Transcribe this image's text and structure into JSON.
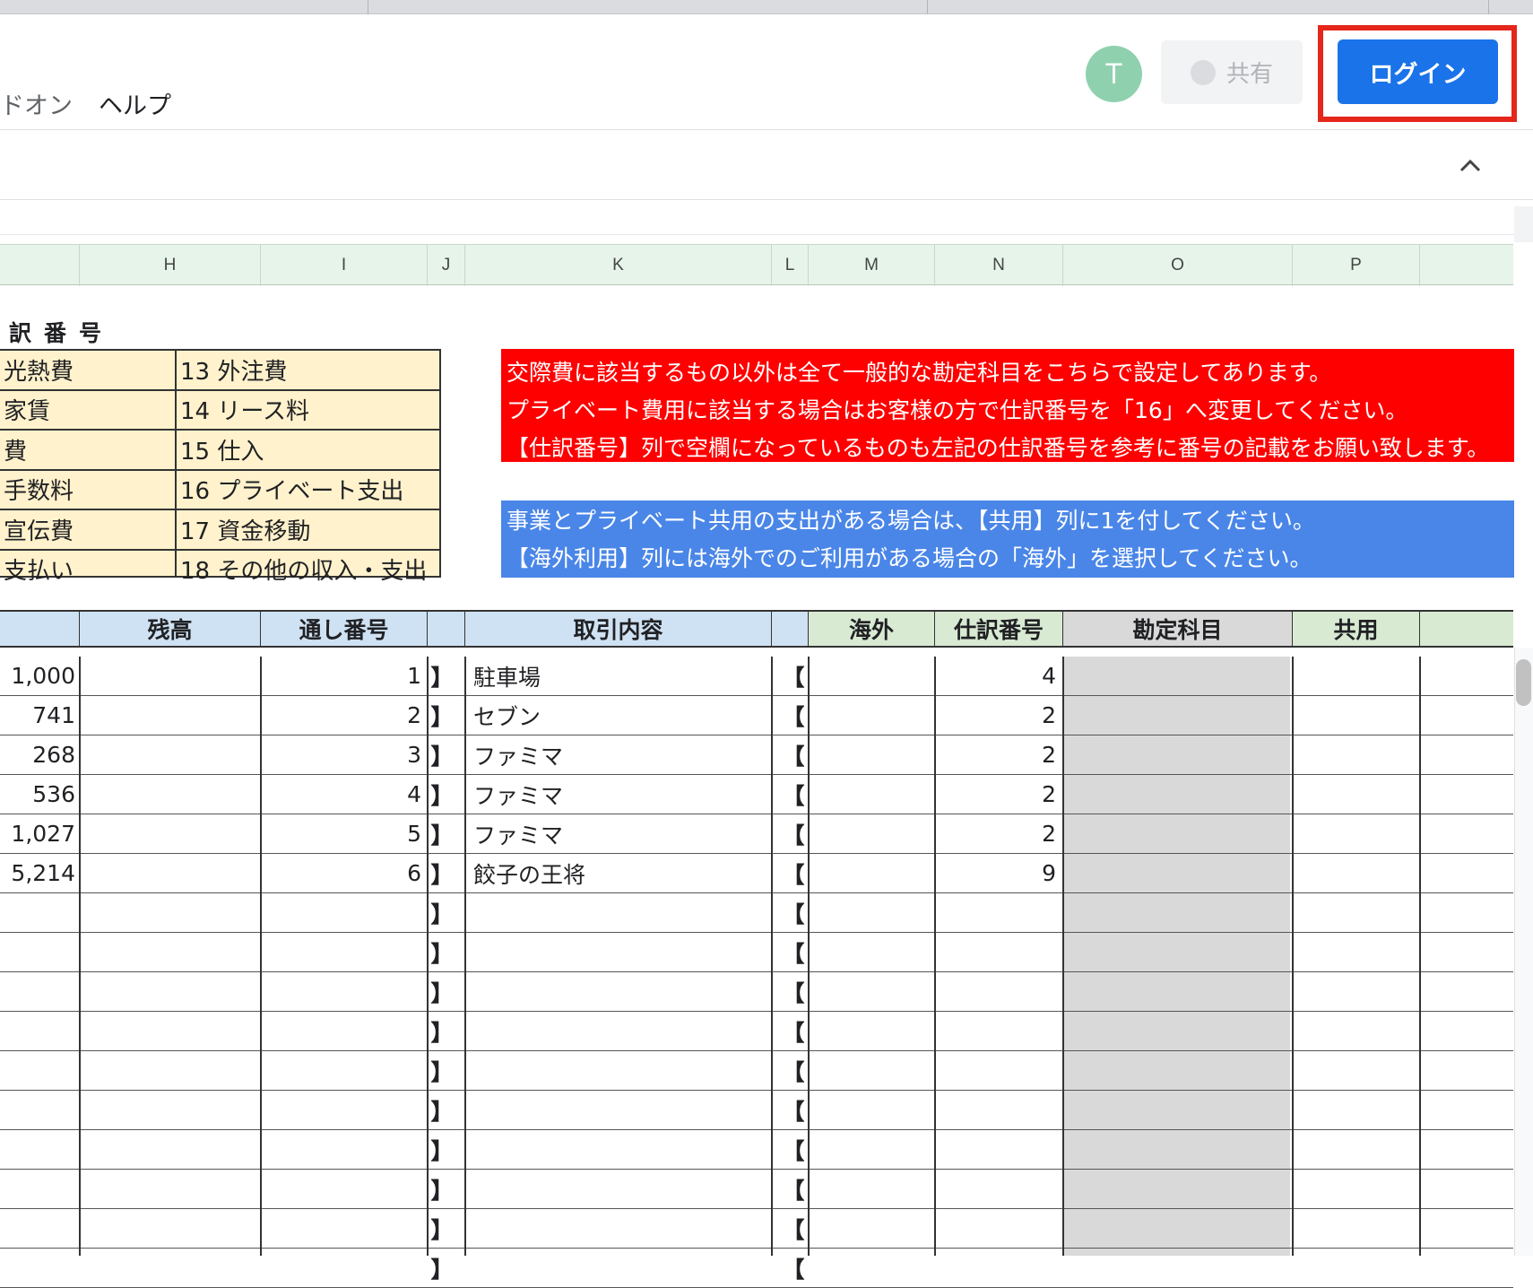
{
  "header": {
    "menu": [
      "ドオン",
      "ヘルプ"
    ],
    "avatar_letter": "T",
    "share_label": "共有",
    "login_label": "ログイン"
  },
  "columns": [
    "H",
    "I",
    "J",
    "K",
    "L",
    "M",
    "N",
    "O",
    "P"
  ],
  "legend": {
    "title": "訳番号",
    "left": [
      "光熱費",
      "家賃",
      "費",
      "手数料",
      "宣伝費",
      "支払い"
    ],
    "right": [
      "13 外注費",
      "14 リース料",
      "15 仕入",
      "16 プライベート支出",
      "17 資金移動",
      "18 その他の収入・支出"
    ]
  },
  "notes": {
    "red": [
      "交際費に該当するもの以外は全て一般的な勘定科目をこちらで設定してあります。",
      "プライベート費用に該当する場合はお客様の方で仕訳番号を「16」へ変更してください。",
      "【仕訳番号】列で空欄になっているものも左記の仕訳番号を参考に番号の記載をお願い致します。"
    ],
    "blue": [
      "事業とプライベート共用の支出がある場合は、【共用】列に1を付してください。",
      "【海外利用】列には海外でのご利用がある場合の「海外」を選択してください。"
    ]
  },
  "table": {
    "headers": {
      "balance": "残高",
      "serial": "通し番号",
      "description": "取引内容",
      "overseas": "海外",
      "journal": "仕訳番号",
      "account": "勘定科目",
      "shared": "共用"
    },
    "open_bracket": "【",
    "close_bracket": "】",
    "rows": [
      {
        "amount": "1,000",
        "serial": "1",
        "desc": "駐車場",
        "journal": "4"
      },
      {
        "amount": "741",
        "serial": "2",
        "desc": "セブン",
        "journal": "2"
      },
      {
        "amount": "268",
        "serial": "3",
        "desc": "ファミマ",
        "journal": "2"
      },
      {
        "amount": "536",
        "serial": "4",
        "desc": "ファミマ",
        "journal": "2"
      },
      {
        "amount": "1,027",
        "serial": "5",
        "desc": "ファミマ",
        "journal": "2"
      },
      {
        "amount": "5,214",
        "serial": "6",
        "desc": "餃子の王将",
        "journal": "9"
      }
    ],
    "empty_rows": 10
  },
  "colors": {
    "login_button": "#1a73e8",
    "login_highlight": "#e5261b",
    "red_note": "#ff0000",
    "blue_note": "#4a86e8",
    "legend_bg": "#fff2cc",
    "avatar": "#8fd1ae"
  }
}
